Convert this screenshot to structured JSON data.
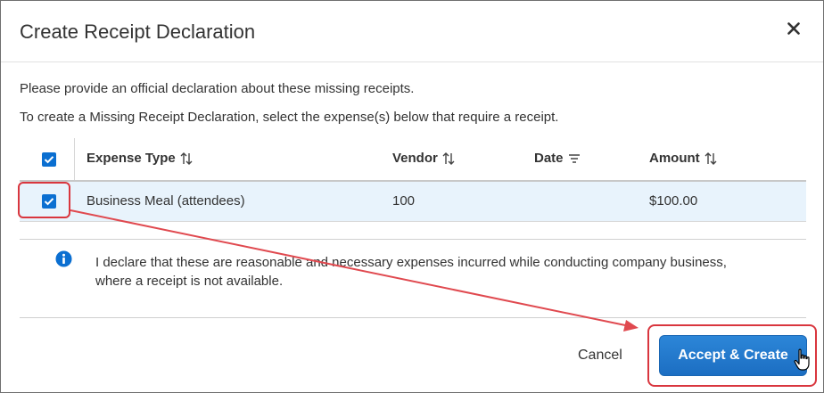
{
  "dialog": {
    "title": "Create Receipt Declaration",
    "close_glyph": "✕",
    "intro": "Please provide an official declaration about these missing receipts.",
    "instruction": "To create a Missing Receipt Declaration, select the expense(s) below that require a receipt."
  },
  "table": {
    "select_all_checked": true,
    "columns": [
      {
        "label": "Expense Type",
        "icon": "sort-icon"
      },
      {
        "label": "Vendor",
        "icon": "sort-icon"
      },
      {
        "label": "Date",
        "icon": "filter-icon"
      },
      {
        "label": "Amount",
        "icon": "sort-icon"
      }
    ],
    "rows": [
      {
        "checked": true,
        "expense_type": "Business Meal (attendees)",
        "vendor": "100",
        "date": "",
        "amount": "$100.00"
      }
    ]
  },
  "declaration": {
    "icon": "info-icon",
    "text": "I declare that these are reasonable and necessary expenses incurred while conducting company business, where a receipt is not available."
  },
  "footer": {
    "cancel_label": "Cancel",
    "primary_label": "Accept & Create"
  },
  "colors": {
    "accent": "#0b6fd1",
    "primary_button": "#1f74c8",
    "row_highlight": "#e8f3fc",
    "annotation": "#d9363e"
  }
}
